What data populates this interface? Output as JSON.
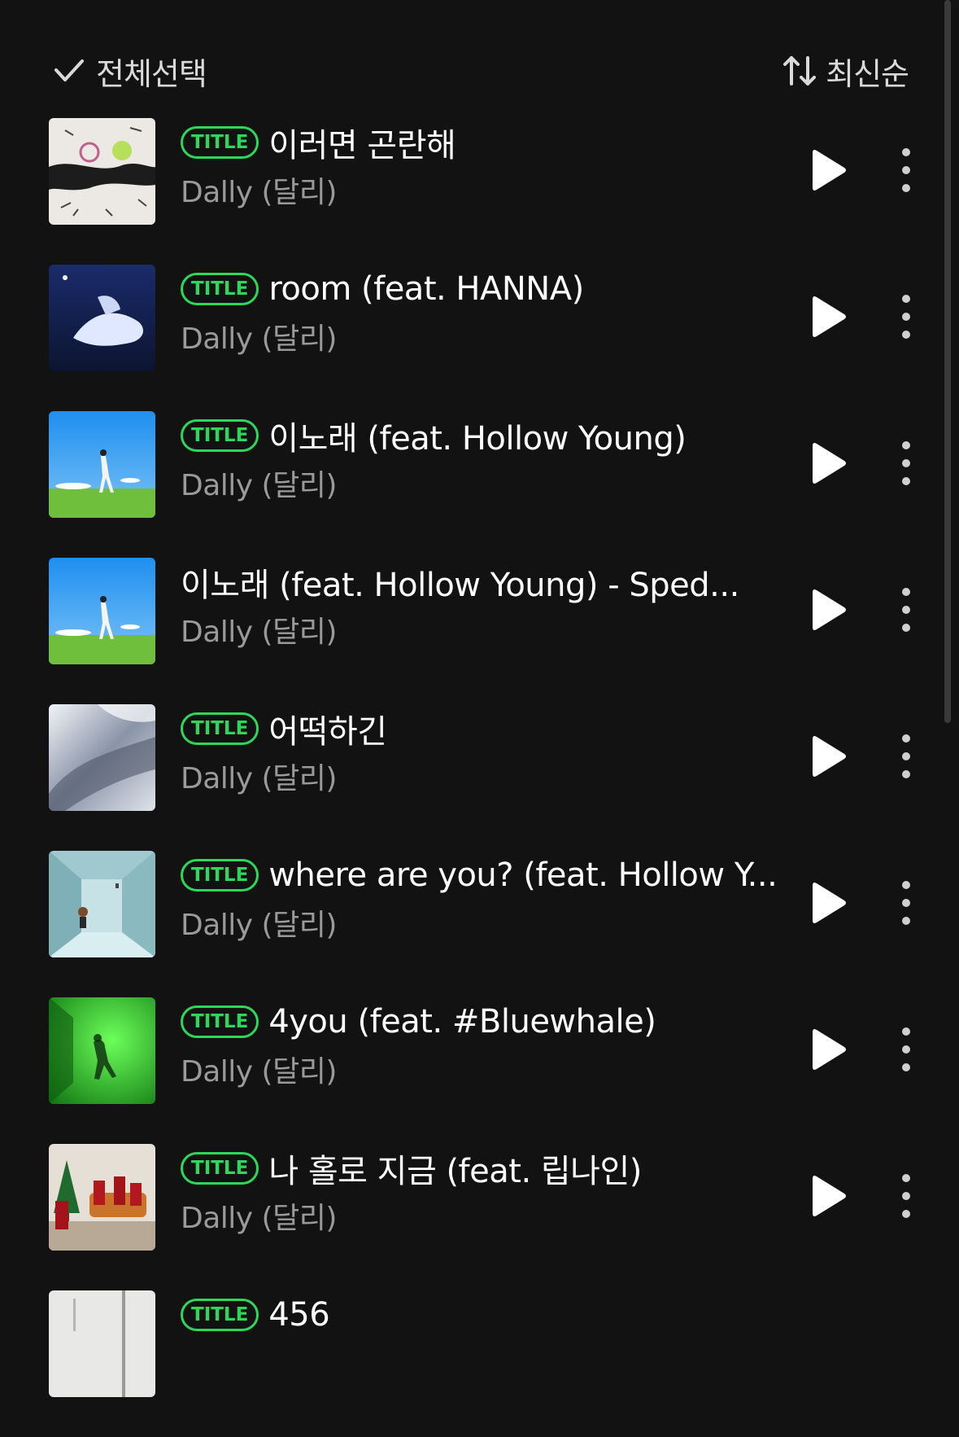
{
  "header": {
    "select_all_label": "전체선택",
    "sort_label": "최신순"
  },
  "tracks": [
    {
      "badge": "TITLE",
      "title": "이러면 곤란해",
      "artist": "Dally (달리)"
    },
    {
      "badge": "TITLE",
      "title": "room (feat. HANNA)",
      "artist": "Dally (달리)"
    },
    {
      "badge": "TITLE",
      "title": "이노래 (feat. Hollow Young)",
      "artist": "Dally (달리)"
    },
    {
      "badge": "",
      "title": "이노래 (feat. Hollow Young) - Sped...",
      "artist": "Dally (달리)"
    },
    {
      "badge": "TITLE",
      "title": "어떡하긴",
      "artist": "Dally (달리)"
    },
    {
      "badge": "TITLE",
      "title": "where are you? (feat. Hollow Y...",
      "artist": "Dally (달리)"
    },
    {
      "badge": "TITLE",
      "title": "4you (feat. #Bluewhale)",
      "artist": "Dally (달리)"
    },
    {
      "badge": "TITLE",
      "title": "나 홀로 지금 (feat. 립나인)",
      "artist": "Dally (달리)"
    },
    {
      "badge": "TITLE",
      "title": "456",
      "artist": ""
    }
  ],
  "colors": {
    "background": "#121212",
    "accent_green": "#2cd75a",
    "artist_text": "#9a9a9a"
  }
}
